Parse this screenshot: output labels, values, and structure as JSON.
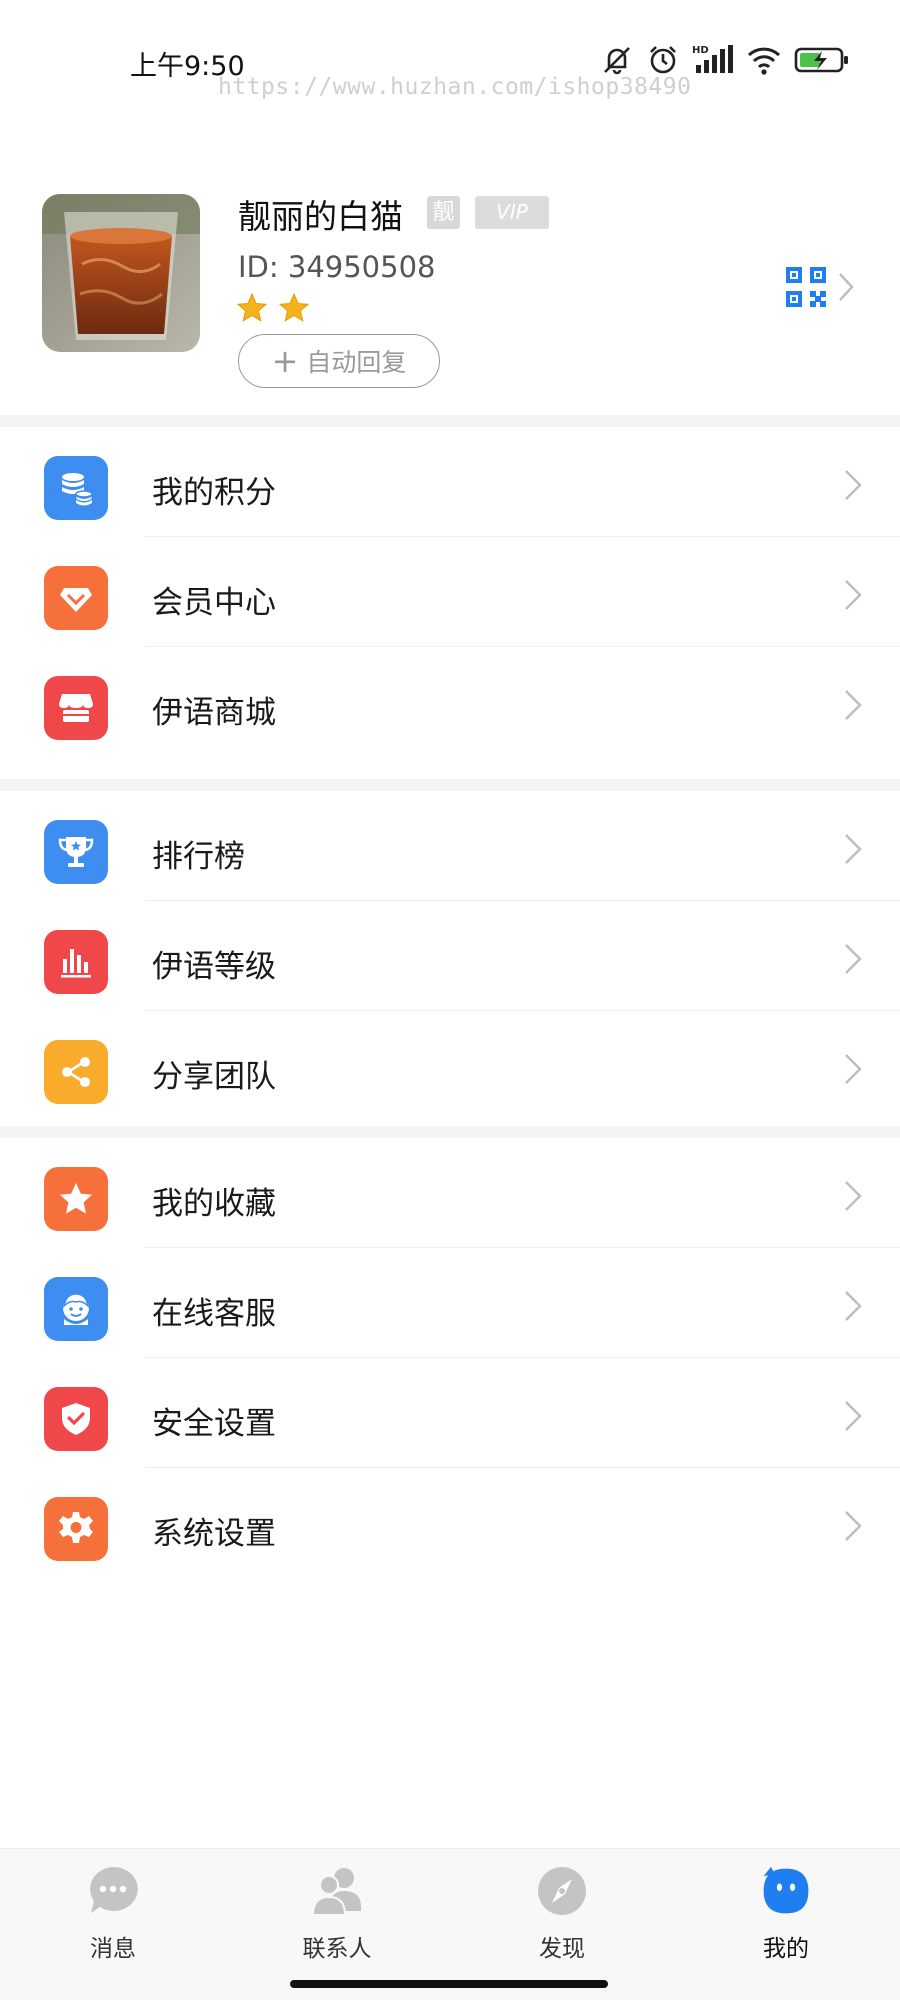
{
  "status_bar": {
    "time": "上午9:50",
    "watermark": "https://www.huzhan.com/ishop38490",
    "icons": [
      "mute-icon",
      "alarm-icon",
      "hd-signal-icon",
      "wifi-icon",
      "battery-charging-icon"
    ]
  },
  "profile": {
    "nickname": "靓丽的白猫",
    "badge_jing": "靓",
    "badge_vip": "VIP",
    "id_text": "ID: 34950508",
    "star_count": 2,
    "auto_reply_label": "自动回复"
  },
  "menu": {
    "groups": [
      {
        "items": [
          {
            "label": "我的积分",
            "icon": "coins-icon",
            "color": "#3d8ef0"
          },
          {
            "label": "会员中心",
            "icon": "diamond-icon",
            "color": "#f5703a"
          },
          {
            "label": "伊语商城",
            "icon": "store-icon",
            "color": "#f0474a"
          }
        ]
      },
      {
        "items": [
          {
            "label": "排行榜",
            "icon": "trophy-icon",
            "color": "#3d8ef0"
          },
          {
            "label": "伊语等级",
            "icon": "bar-chart-icon",
            "color": "#f0474a"
          },
          {
            "label": "分享团队",
            "icon": "share-icon",
            "color": "#f9ab2c"
          }
        ]
      },
      {
        "items": [
          {
            "label": "我的收藏",
            "icon": "star-icon",
            "color": "#f5703a"
          },
          {
            "label": "在线客服",
            "icon": "service-agent-icon",
            "color": "#3d8ef0"
          },
          {
            "label": "安全设置",
            "icon": "shield-check-icon",
            "color": "#f0474a"
          },
          {
            "label": "系统设置",
            "icon": "gear-icon",
            "color": "#f5703a"
          }
        ]
      }
    ]
  },
  "bottom_nav": {
    "items": [
      {
        "label": "消息",
        "icon": "chat-bubble-icon"
      },
      {
        "label": "联系人",
        "icon": "contacts-icon"
      },
      {
        "label": "发现",
        "icon": "compass-icon"
      },
      {
        "label": "我的",
        "icon": "me-face-icon",
        "active": true
      }
    ],
    "accent": "#1f7ef0",
    "inactive": "#c4c4c4"
  }
}
